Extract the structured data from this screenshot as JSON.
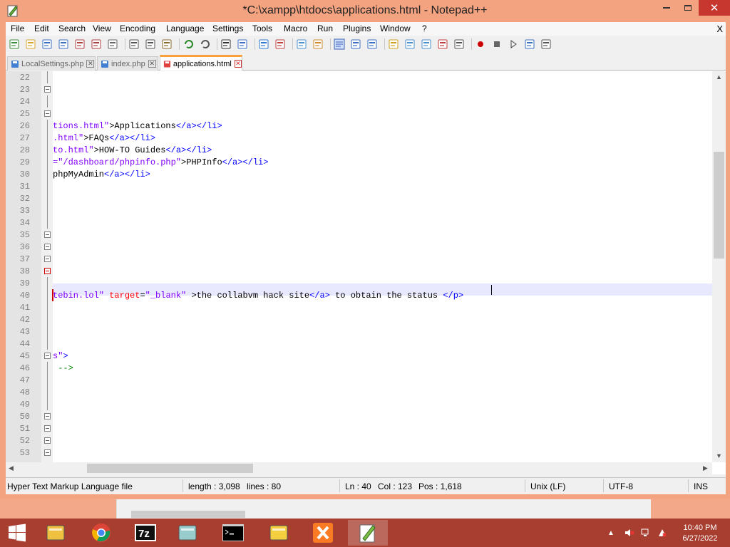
{
  "window": {
    "title": "*C:\\xampp\\htdocs\\applications.html - Notepad++",
    "close_label": "✕",
    "min_label": "—",
    "max_label": "☐"
  },
  "menu": {
    "items": [
      "File",
      "Edit",
      "Search",
      "View",
      "Encoding",
      "Language",
      "Settings",
      "Tools",
      "Macro",
      "Run",
      "Plugins",
      "Window",
      "?"
    ],
    "close_doc": "X"
  },
  "tabs": [
    {
      "label": "LocalSettings.php",
      "active": false
    },
    {
      "label": "index.php",
      "active": false
    },
    {
      "label": "applications.html",
      "active": true
    }
  ],
  "editor": {
    "line_numbers": [
      "22",
      "23",
      "24",
      "25",
      "26",
      "27",
      "28",
      "29",
      "30",
      "31",
      "32",
      "33",
      "34",
      "35",
      "36",
      "37",
      "38",
      "39",
      "40",
      "41",
      "42",
      "43",
      "44",
      "45",
      "46",
      "47",
      "48",
      "49",
      "50",
      "51",
      "52",
      "53"
    ],
    "lines": [
      [],
      [],
      [],
      [],
      [
        {
          "t": "str",
          "v": "tions.html\""
        },
        {
          "t": "text",
          "v": ">Applications"
        },
        {
          "t": "tag",
          "v": "</a></li>"
        }
      ],
      [
        {
          "t": "str",
          "v": ".html\""
        },
        {
          "t": "text",
          "v": ">FAQs"
        },
        {
          "t": "tag",
          "v": "</a></li>"
        }
      ],
      [
        {
          "t": "str",
          "v": "to.html\""
        },
        {
          "t": "text",
          "v": ">HOW-TO Guides"
        },
        {
          "t": "tag",
          "v": "</a></li>"
        }
      ],
      [
        {
          "t": "str",
          "v": "=\"/dashboard/phpinfo.php\""
        },
        {
          "t": "text",
          "v": ">PHPInfo"
        },
        {
          "t": "tag",
          "v": "</a></li>"
        }
      ],
      [
        {
          "t": "text",
          "v": "phpMyAdmin"
        },
        {
          "t": "tag",
          "v": "</a></li>"
        }
      ],
      [],
      [],
      [],
      [],
      [],
      [],
      [],
      [],
      [],
      [
        {
          "t": "str",
          "v": "tebin.lol\" "
        },
        {
          "t": "attr",
          "v": "target"
        },
        {
          "t": "text",
          "v": "="
        },
        {
          "t": "str",
          "v": "\"_blank\" "
        },
        {
          "t": "text",
          "v": ">the collabvm hack site"
        },
        {
          "t": "tag",
          "v": "</a>"
        },
        {
          "t": "text",
          "v": " to obtain the status "
        },
        {
          "t": "tag",
          "v": "</p>"
        }
      ],
      [],
      [],
      [],
      [],
      [
        {
          "t": "str",
          "v": "s\""
        },
        {
          "t": "tag",
          "v": ">"
        }
      ],
      [
        {
          "t": "cmt",
          "v": " -->"
        }
      ],
      [],
      [],
      [],
      [],
      [],
      [],
      []
    ],
    "fold_lines": [
      "23",
      "25",
      "35",
      "36",
      "37",
      "38",
      "45",
      "50",
      "51",
      "52",
      "53"
    ],
    "fold_red": "38",
    "current_line": "40"
  },
  "status": {
    "filetype": "Hyper Text Markup Language file",
    "length": "length : 3,098",
    "lines": "lines : 80",
    "ln": "Ln : 40",
    "col": "Col : 123",
    "pos": "Pos : 1,618",
    "eol": "Unix (LF)",
    "encoding": "UTF-8",
    "mode": "INS"
  },
  "taskbar": {
    "time": "10:40 PM",
    "date": "6/27/2022",
    "icons": [
      "windows-start-icon",
      "file-explorer-icon",
      "chrome-icon",
      "7zip-icon",
      "notepad-icon",
      "cmd-icon",
      "sticky-notes-icon",
      "xampp-icon",
      "notepadpp-icon"
    ]
  },
  "colors": {
    "accent": "#f4a381",
    "tab_active": "#f8a03c",
    "taskbar": "#a83e30"
  }
}
